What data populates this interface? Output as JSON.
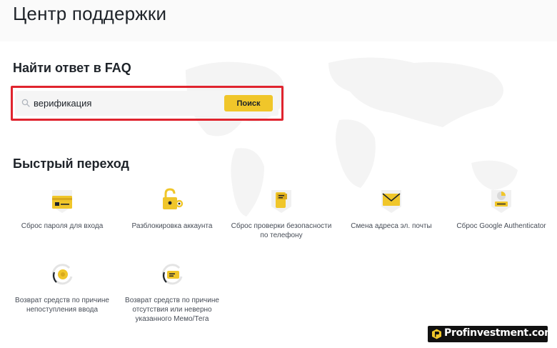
{
  "header": {
    "title": "Центр поддержки"
  },
  "faq": {
    "heading": "Найти ответ в FAQ",
    "search_value": "верификация",
    "search_button": "Поиск"
  },
  "quick": {
    "heading": "Быстрый переход",
    "items": [
      {
        "label": "Сброс пароля для входа",
        "icon": "password-reset-card-icon"
      },
      {
        "label": "Разблокировка аккаунта",
        "icon": "unlock-padlock-icon"
      },
      {
        "label": "Сброс проверки безопасности по телефону",
        "icon": "phone-security-reset-icon"
      },
      {
        "label": "Смена адреса эл. почты",
        "icon": "email-envelope-icon"
      },
      {
        "label": "Сброс Google Authenticator",
        "icon": "authenticator-reset-icon"
      },
      {
        "label": "Возврат средств по причине непоступления ввода",
        "icon": "refund-coin-icon"
      },
      {
        "label": "Возврат средств по причине отсутствия или неверно указанного Мемо/Тега",
        "icon": "refund-memo-tag-icon"
      }
    ]
  },
  "watermark": {
    "text": "Profinvestment.com"
  },
  "colors": {
    "accent": "#f0c62a",
    "highlight": "#e0242e",
    "text": "#1e2329"
  }
}
